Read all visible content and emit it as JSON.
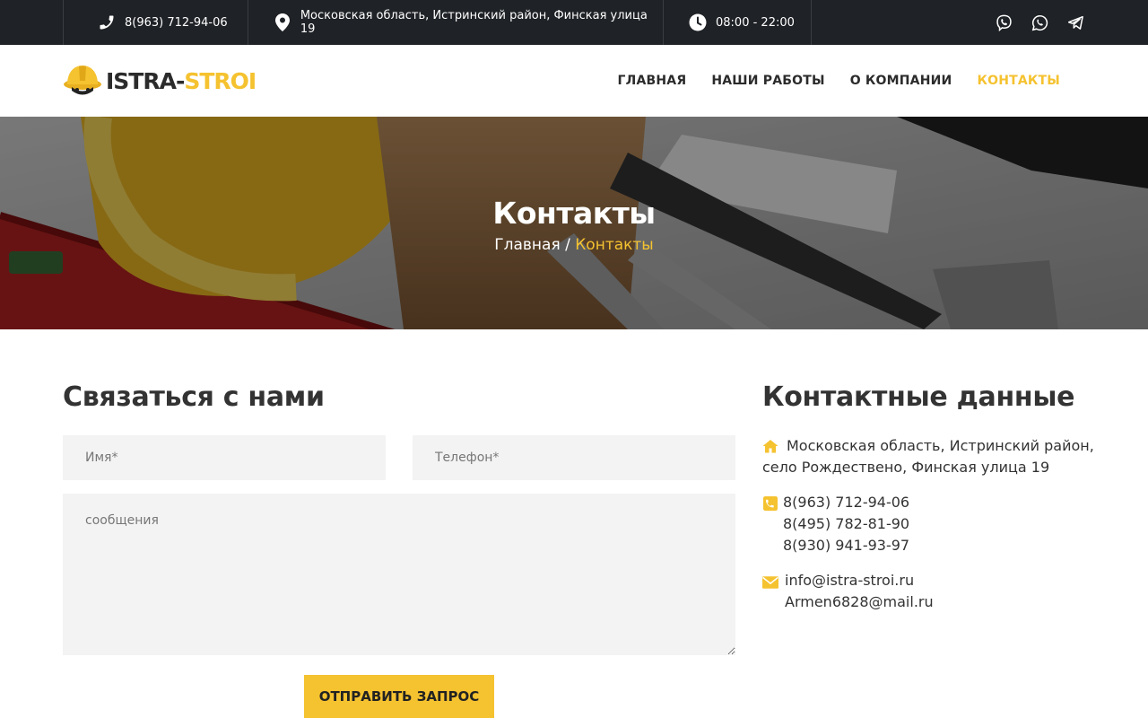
{
  "topbar": {
    "phone": "8(963) 712-94-06",
    "address": "Московская область, Истринский район, Финская улица 19",
    "hours": "08:00 - 22:00",
    "socials": [
      "viber-icon",
      "whatsapp-icon",
      "telegram-icon"
    ]
  },
  "header": {
    "logo_part1": "ISTRA-",
    "logo_part2": "STROI",
    "nav": [
      "ГЛАВНАЯ",
      "НАШИ РАБОТЫ",
      "О КОМПАНИИ",
      "КОНТАКТЫ"
    ],
    "active_nav": "КОНТАКТЫ"
  },
  "hero": {
    "title": "Контакты",
    "crumb_home": "Главная",
    "crumb_sep": "/",
    "crumb_current": "Контакты"
  },
  "form": {
    "title": "Связаться с нами",
    "name_placeholder": "Имя*",
    "phone_placeholder": "Телефон*",
    "message_placeholder": "сообщения",
    "submit_label": "ОТПРАВИТЬ ЗАПРОС"
  },
  "contacts": {
    "title": "Контактные данные",
    "address_line1": "Московская область, Истринский район,",
    "address_line2": "село Рождествено, Финская улица 19",
    "phones": [
      "8(963) 712-94-06",
      "8(495) 782-81-90",
      "8(930) 941-93-97"
    ],
    "emails": [
      "info@istra-stroi.ru",
      "Armen6828@mail.ru"
    ]
  },
  "colors": {
    "accent": "#f5c230",
    "topbar": "#1f2226",
    "text": "#333333",
    "field_bg": "#f3f3f3"
  }
}
